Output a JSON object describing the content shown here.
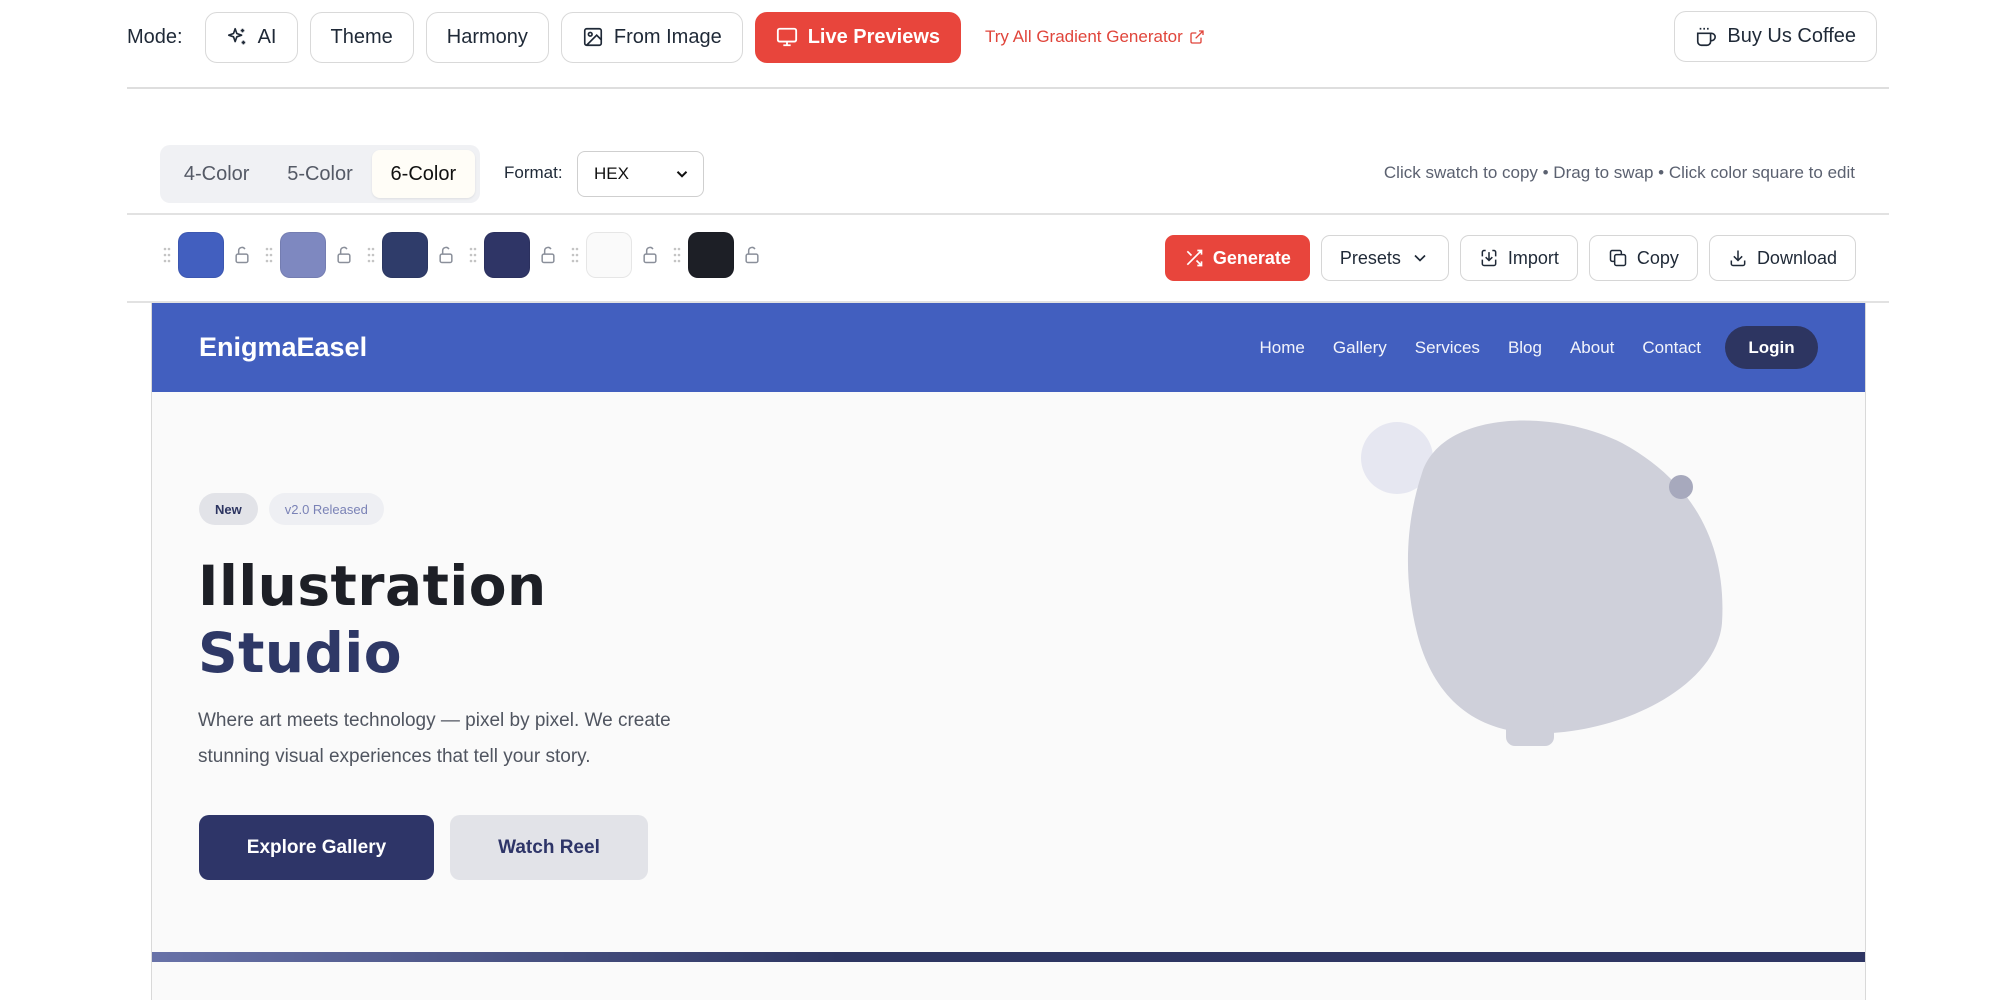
{
  "modebar": {
    "label": "Mode:",
    "modes": [
      {
        "label": "AI",
        "icon": "sparkles-icon"
      },
      {
        "label": "Theme",
        "icon": ""
      },
      {
        "label": "Harmony",
        "icon": ""
      },
      {
        "label": "From Image",
        "icon": "image-icon"
      },
      {
        "label": "Live Previews",
        "icon": "monitor-icon",
        "active": true
      }
    ],
    "try_link": "Try All Gradient Generator",
    "coffee_label": "Buy Us Coffee"
  },
  "palette_size": {
    "options": [
      "4-Color",
      "5-Color",
      "6-Color"
    ],
    "selected": "6-Color"
  },
  "format": {
    "label": "Format:",
    "value": "HEX"
  },
  "hint": "Click swatch to copy • Drag to swap • Click color square to edit",
  "swatches": [
    {
      "color": "#425fbf"
    },
    {
      "color": "#7e88c0"
    },
    {
      "color": "#2f3c6a"
    },
    {
      "color": "#2f3566"
    },
    {
      "color": "#fafafa"
    },
    {
      "color": "#1d1f26"
    }
  ],
  "actions": {
    "generate": "Generate",
    "presets": "Presets",
    "import": "Import",
    "copy": "Copy",
    "download": "Download"
  },
  "preview": {
    "brand": "EnigmaEasel",
    "nav_links": [
      "Home",
      "Gallery",
      "Services",
      "Blog",
      "About",
      "Contact"
    ],
    "login": "Login",
    "badge_new": "New",
    "badge_version": "v2.0 Released",
    "title_line1": "Illustration",
    "title_line2": "Studio",
    "lead": "Where art meets technology — pixel by pixel. We create stunning visual experiences that tell your story.",
    "primary_cta": "Explore Gallery",
    "secondary_cta": "Watch Reel"
  },
  "colors": {
    "accent_red": "#e8453c",
    "nav_bg": "#425fbf",
    "dark_navy": "#2e3568"
  }
}
